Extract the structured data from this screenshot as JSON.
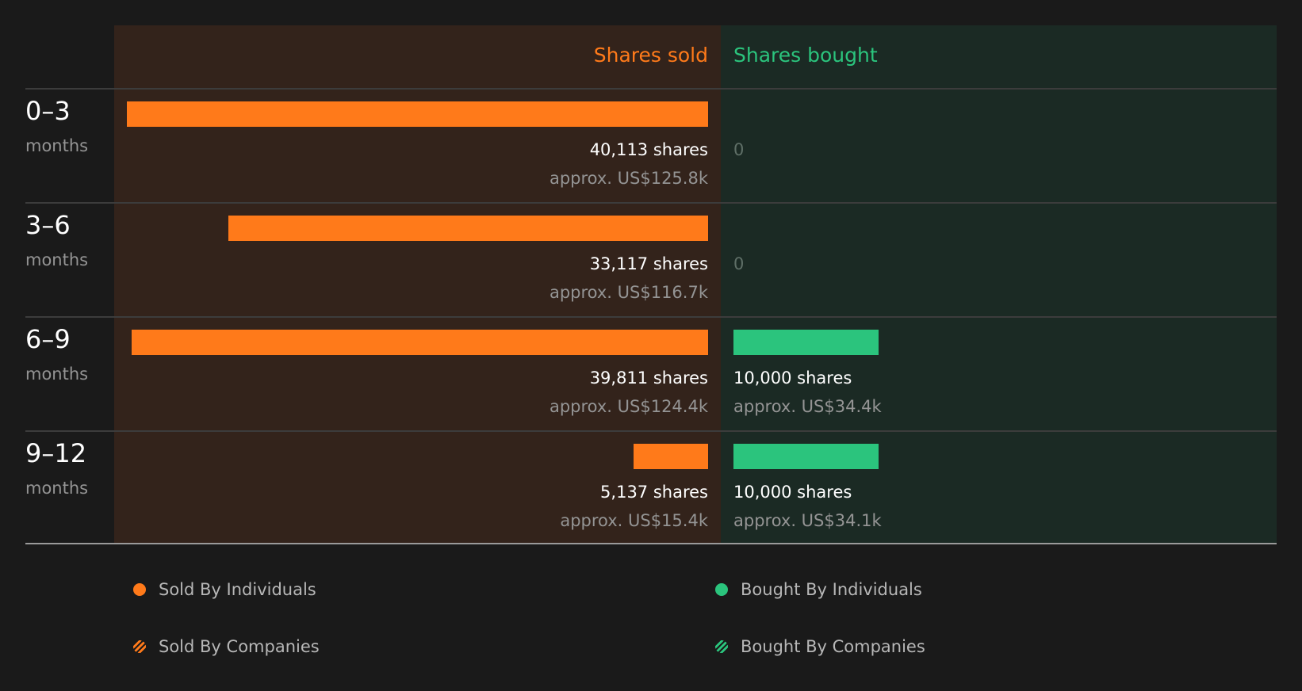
{
  "colors": {
    "sold": "#ff7a1a",
    "bought": "#2bc47d",
    "sold_header": "#ff7a1a",
    "bought_header": "#2bc47d"
  },
  "headers": {
    "sold": "Shares sold",
    "bought": "Shares bought"
  },
  "chart_data": {
    "type": "bar",
    "categories": [
      "0–3",
      "3–6",
      "6–9",
      "9–12"
    ],
    "unit_label": "months",
    "series": [
      {
        "name": "Shares sold",
        "values": [
          40113,
          33117,
          39811,
          5137
        ],
        "labels": [
          "40,113 shares",
          "33,117 shares",
          "39,811 shares",
          "5,137 shares"
        ],
        "approx": [
          "approx. US$125.8k",
          "approx. US$116.7k",
          "approx. US$124.4k",
          "approx. US$15.4k"
        ]
      },
      {
        "name": "Shares bought",
        "values": [
          0,
          0,
          10000,
          10000
        ],
        "labels": [
          "0",
          "0",
          "10,000 shares",
          "10,000 shares"
        ],
        "approx": [
          "",
          "",
          "approx. US$34.4k",
          "approx. US$34.1k"
        ]
      }
    ],
    "xlim": [
      0,
      40113
    ]
  },
  "legend": [
    {
      "label": "Sold By Individuals",
      "color": "#ff7a1a",
      "style": "solid"
    },
    {
      "label": "Bought By Individuals",
      "color": "#2bc47d",
      "style": "solid"
    },
    {
      "label": "Sold By Companies",
      "color": "#ff7a1a",
      "style": "hatched"
    },
    {
      "label": "Bought By Companies",
      "color": "#2bc47d",
      "style": "hatched"
    }
  ]
}
